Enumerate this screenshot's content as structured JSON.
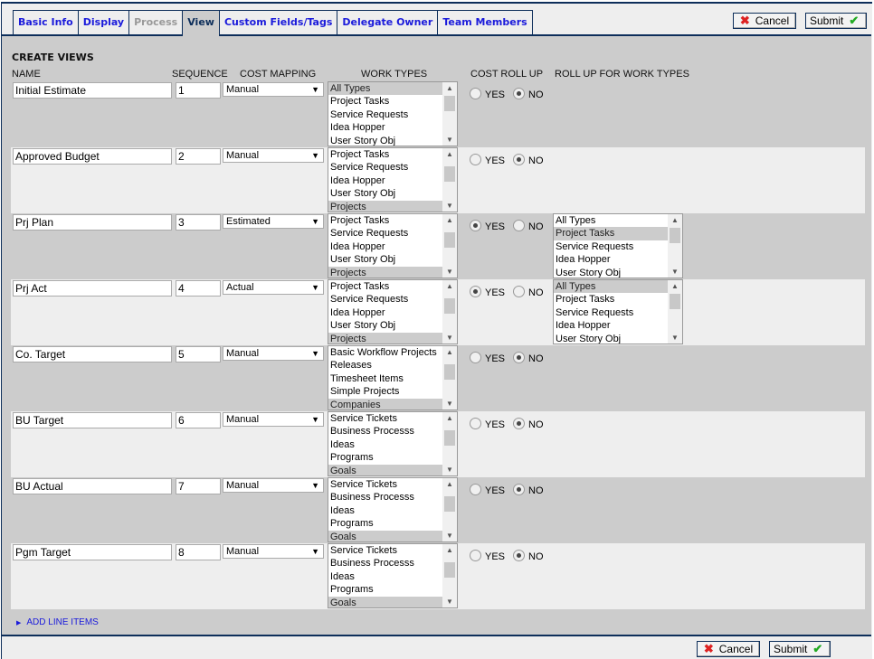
{
  "tabs": [
    {
      "label": "Basic Info",
      "state": "normal"
    },
    {
      "label": "Display",
      "state": "normal"
    },
    {
      "label": "Process",
      "state": "disabled"
    },
    {
      "label": "View",
      "state": "active"
    },
    {
      "label": "Custom Fields/Tags",
      "state": "normal"
    },
    {
      "label": "Delegate Owner",
      "state": "normal"
    },
    {
      "label": "Team Members",
      "state": "normal"
    }
  ],
  "buttons": {
    "cancel": "Cancel",
    "submit": "Submit",
    "cancel_icon": "x-icon",
    "submit_icon": "checkmark-icon"
  },
  "section_title": "CREATE VIEWS",
  "columns": {
    "name": "NAME",
    "sequence": "SEQUENCE",
    "cost_mapping": "COST MAPPING",
    "work_types": "WORK TYPES",
    "cost_roll_up": "COST ROLL UP",
    "roll_up_for_work_types": "ROLL UP FOR WORK TYPES"
  },
  "radio_labels": {
    "yes": "YES",
    "no": "NO"
  },
  "rows": [
    {
      "name": "Initial Estimate",
      "sequence": "1",
      "cost_mapping": "Manual",
      "work_types": [
        "All Types",
        "Project Tasks",
        "Service Requests",
        "Idea Hopper",
        "User Story Obj"
      ],
      "selected": [
        0
      ],
      "roll_up": "NO"
    },
    {
      "name": "Approved Budget",
      "sequence": "2",
      "cost_mapping": "Manual",
      "work_types": [
        "Project Tasks",
        "Service Requests",
        "Idea Hopper",
        "User Story Obj",
        "Projects"
      ],
      "selected": [
        4
      ],
      "roll_up": "NO"
    },
    {
      "name": "Prj Plan",
      "sequence": "3",
      "cost_mapping": "Estimated",
      "work_types": [
        "Project Tasks",
        "Service Requests",
        "Idea Hopper",
        "User Story Obj",
        "Projects"
      ],
      "selected": [
        4
      ],
      "roll_up": "YES",
      "roll_up_types": [
        "All Types",
        "Project Tasks",
        "Service Requests",
        "Idea Hopper",
        "User Story Obj"
      ],
      "roll_up_selected": [
        1
      ]
    },
    {
      "name": "Prj Act",
      "sequence": "4",
      "cost_mapping": "Actual",
      "work_types": [
        "Project Tasks",
        "Service Requests",
        "Idea Hopper",
        "User Story Obj",
        "Projects"
      ],
      "selected": [
        4
      ],
      "roll_up": "YES",
      "roll_up_types": [
        "All Types",
        "Project Tasks",
        "Service Requests",
        "Idea Hopper",
        "User Story Obj"
      ],
      "roll_up_selected": [
        0
      ]
    },
    {
      "name": "Co. Target",
      "sequence": "5",
      "cost_mapping": "Manual",
      "work_types": [
        "Basic Workflow Projects",
        "Releases",
        "Timesheet Items",
        "Simple Projects",
        "Companies"
      ],
      "selected": [
        4
      ],
      "roll_up": "NO"
    },
    {
      "name": "BU Target",
      "sequence": "6",
      "cost_mapping": "Manual",
      "work_types": [
        "Service Tickets",
        "Business Processs",
        "Ideas",
        "Programs",
        "Goals"
      ],
      "selected": [
        4
      ],
      "roll_up": "NO"
    },
    {
      "name": "BU Actual",
      "sequence": "7",
      "cost_mapping": "Manual",
      "work_types": [
        "Service Tickets",
        "Business Processs",
        "Ideas",
        "Programs",
        "Goals"
      ],
      "selected": [
        4
      ],
      "roll_up": "NO"
    },
    {
      "name": "Pgm Target",
      "sequence": "8",
      "cost_mapping": "Manual",
      "work_types": [
        "Service Tickets",
        "Business Processs",
        "Ideas",
        "Programs",
        "Goals"
      ],
      "selected": [
        4
      ],
      "roll_up": "NO"
    }
  ],
  "add_line_items": "ADD LINE ITEMS"
}
